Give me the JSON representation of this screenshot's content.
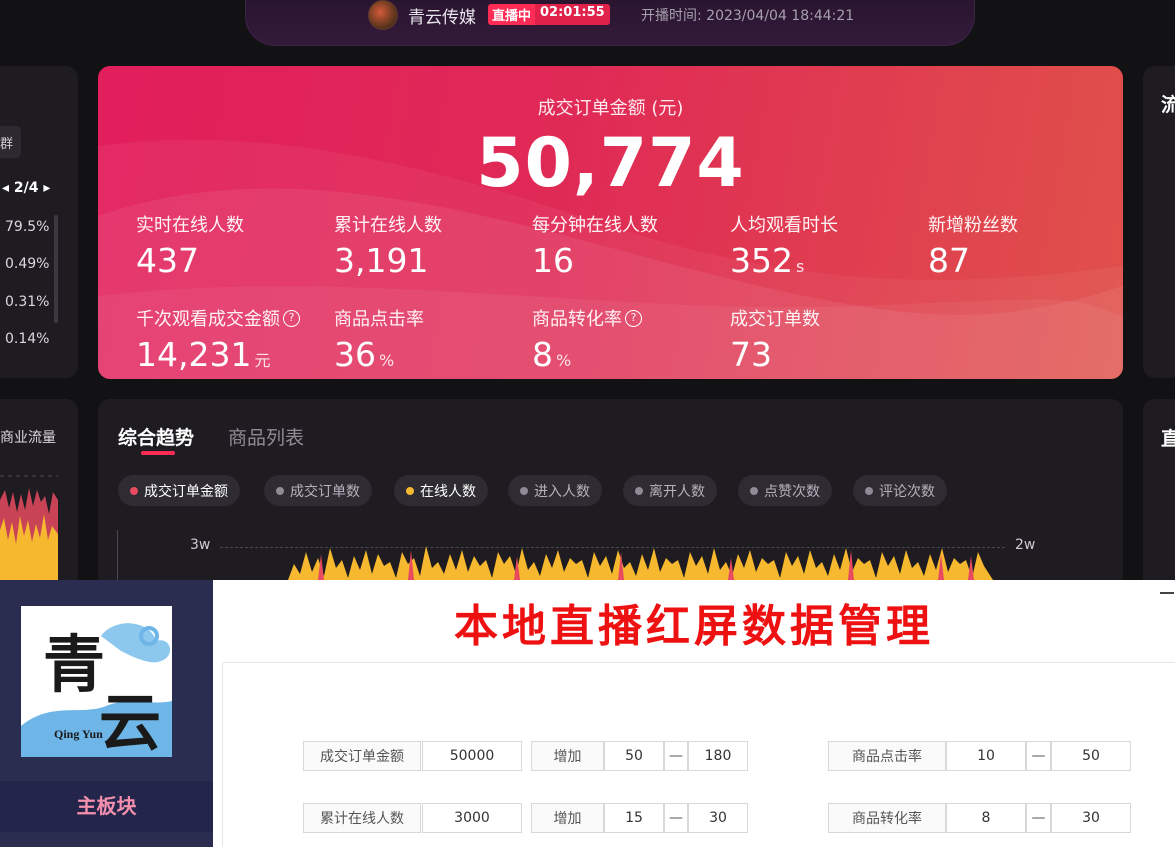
{
  "header": {
    "channel_name": "青云传媒",
    "live_label": "直播中",
    "live_duration": "02:01:55",
    "start_time": "开播时间: 2023/04/04 18:44:21"
  },
  "left_panel": {
    "chip_label": "群",
    "pager": "◂ 2/4 ▸",
    "percentages": [
      "79.5%",
      "0.49%",
      "0.31%",
      "0.14%"
    ],
    "section_label": "商业流量"
  },
  "right_panel": {
    "top_label": "流",
    "bottom_label": "直"
  },
  "kpi": {
    "title": "成交订单金额 (元)",
    "main_value": "50,774",
    "metrics": [
      {
        "label": "实时在线人数",
        "value": "437",
        "unit": "",
        "help": false
      },
      {
        "label": "累计在线人数",
        "value": "3,191",
        "unit": "",
        "help": false
      },
      {
        "label": "每分钟在线人数",
        "value": "16",
        "unit": "",
        "help": false
      },
      {
        "label": "人均观看时长",
        "value": "352",
        "unit": "s",
        "help": false
      },
      {
        "label": "新增粉丝数",
        "value": "87",
        "unit": "",
        "help": false
      },
      {
        "label": "千次观看成交金额",
        "value": "14,231",
        "unit": "元",
        "help": true
      },
      {
        "label": "商品点击率",
        "value": "36",
        "unit": "%",
        "help": false
      },
      {
        "label": "商品转化率",
        "value": "8",
        "unit": "%",
        "help": true
      },
      {
        "label": "成交订单数",
        "value": "73",
        "unit": "",
        "help": false
      }
    ],
    "help_glyph": "?"
  },
  "trend": {
    "tabs": [
      {
        "label": "综合趋势",
        "active": true
      },
      {
        "label": "商品列表",
        "active": false
      }
    ],
    "chips": [
      {
        "label": "成交订单金额",
        "dot_color": "#e84a5f",
        "active": true
      },
      {
        "label": "成交订单数",
        "dot_color": "#8f8a96",
        "active": false
      },
      {
        "label": "在线人数",
        "dot_color": "#f5b82e",
        "active": true
      },
      {
        "label": "进入人数",
        "dot_color": "#8f8a96",
        "active": false
      },
      {
        "label": "离开人数",
        "dot_color": "#8f8a96",
        "active": false
      },
      {
        "label": "点赞次数",
        "dot_color": "#8f8a96",
        "active": false
      },
      {
        "label": "评论次数",
        "dot_color": "#8f8a96",
        "active": false
      }
    ],
    "axis_left_label": "3w",
    "axis_right_label": "2w",
    "series_colors": {
      "online": "#f5b82e",
      "amount": "#e84a5f"
    }
  },
  "app": {
    "logo_chars": [
      "青",
      "云"
    ],
    "logo_en": "Qing Yun",
    "menu_active": "主板块",
    "title": "本地直播红屏数据管理",
    "rows": [
      {
        "label": "成交订单金额",
        "value": "50000",
        "inc_label": "增加",
        "inc_min": "50",
        "separator": "—",
        "inc_max": "180",
        "rate_label": "商品点击率",
        "rate_min": "10",
        "rate_max": "50"
      },
      {
        "label": "累计在线人数",
        "value": "3000",
        "inc_label": "增加",
        "inc_min": "15",
        "separator": "—",
        "inc_max": "30",
        "rate_label": "商品转化率",
        "rate_min": "8",
        "rate_max": "30"
      }
    ]
  },
  "colors": {
    "accent": "#fe2c55",
    "panel_red_start": "#e21e5c",
    "panel_red_end": "#e0514a",
    "title_red": "#ee1111",
    "sidebar": "#2a2d50",
    "menu_text": "#f58fae"
  }
}
